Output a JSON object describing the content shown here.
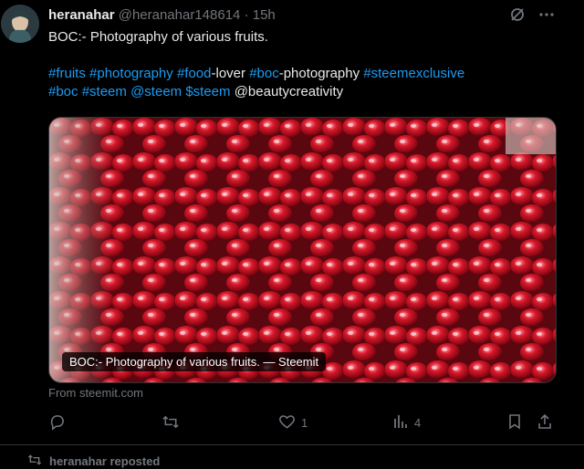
{
  "tweet": {
    "display_name": "heranahar",
    "handle": "@heranahar148614",
    "dot": "·",
    "time": "15h",
    "text_line1": "BOC:- Photography of various fruits.",
    "tags": {
      "fruits": "#fruits",
      "photography": "#photography",
      "food": "#food",
      "lover": "-lover",
      "boc": "#boc",
      "boc_photography": "-photography",
      "steemexclusive": "#steemexclusive",
      "boc2": "#boc",
      "steem": "#steem",
      "at_steem": "@steem",
      "cash_steem": "$steem",
      "beautycreativity": "@beautycreativity"
    },
    "link_card": {
      "caption": "BOC:- Photography of various fruits. — Steemit",
      "source": "From steemit.com"
    },
    "actions": {
      "likes": "1",
      "views": "4"
    }
  },
  "next_item": {
    "repost_label": "heranahar reposted"
  },
  "icons": {
    "grok": "grok-icon",
    "more": "more-icon",
    "reply": "reply-icon",
    "retweet": "retweet-icon",
    "like": "heart-icon",
    "views": "views-icon",
    "bookmark": "bookmark-icon",
    "share": "share-icon"
  },
  "colors": {
    "background": "#000000",
    "text": "#e7e9ea",
    "muted": "#71767b",
    "link": "#1d9bf0"
  }
}
